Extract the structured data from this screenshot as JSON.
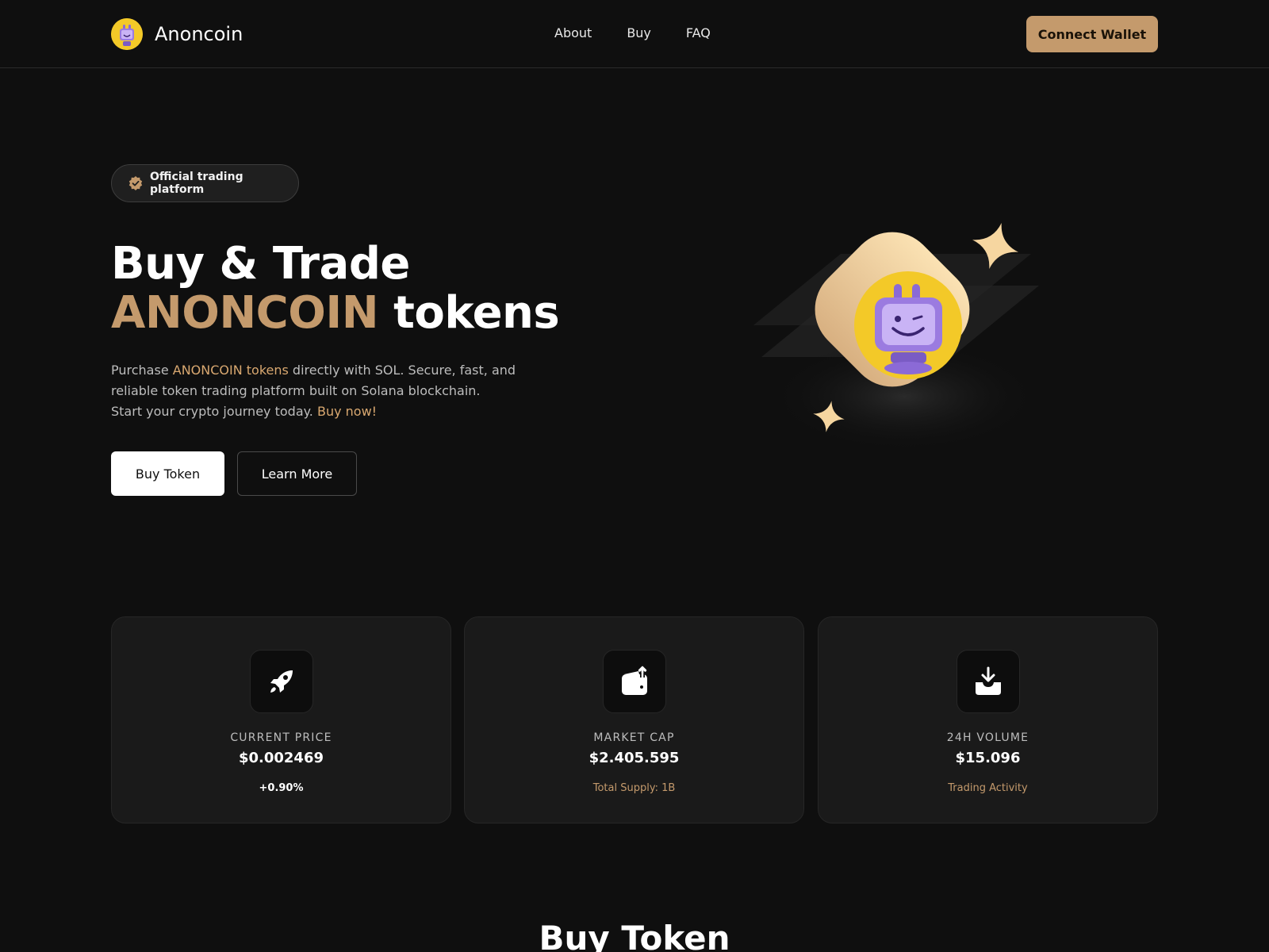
{
  "nav": {
    "brand": "Anoncoin",
    "links": [
      "About",
      "Buy",
      "FAQ"
    ],
    "connect_label": "Connect Wallet"
  },
  "hero": {
    "badge": "Official trading platform",
    "headline_line1": "Buy & Trade",
    "headline_accent": "ANONCOIN",
    "headline_rest": " tokens",
    "desc_part1": "Purchase ",
    "desc_hl1": "ANONCOIN tokens",
    "desc_part2": " directly with SOL. Secure, fast, and reliable token trading platform built on Solana blockchain.",
    "desc_part3": "Start your crypto journey today. ",
    "desc_hl2": "Buy now!",
    "buy_label": "Buy Token",
    "learn_label": "Learn More"
  },
  "stats": [
    {
      "icon": "rocket-icon",
      "label": "CURRENT PRICE",
      "value": "$0.002469",
      "sub": "+0.90%"
    },
    {
      "icon": "wallet-icon",
      "label": "MARKET CAP",
      "value": "$2.405.595",
      "sub": "Total Supply: 1B"
    },
    {
      "icon": "download-icon",
      "label": "24H VOLUME",
      "value": "$15.096",
      "sub": "Trading Activity"
    }
  ],
  "section_title": "Buy Token",
  "colors": {
    "accent": "#c49a6c",
    "background": "#0f0f0f",
    "card": "#1a1a1a",
    "logo_yellow": "#f3c928",
    "mascot_purple": "#8b6ad6"
  }
}
